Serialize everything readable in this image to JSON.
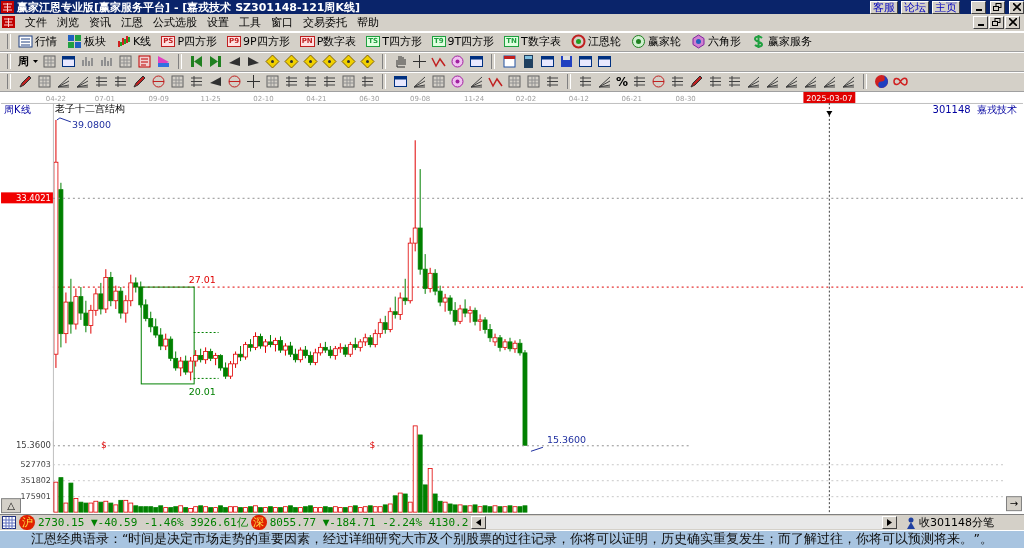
{
  "window": {
    "title": "赢家江恩专业版[赢家服务平台] - [嘉戎技术   SZ301148-121周K线]",
    "links": [
      "客服",
      "论坛",
      "主页"
    ]
  },
  "menu": [
    "文件",
    "浏览",
    "资讯",
    "江恩",
    "公式选股",
    "设置",
    "工具",
    "窗口",
    "交易委托",
    "帮助"
  ],
  "toolbar": [
    {
      "label": "行情"
    },
    {
      "label": "板块"
    },
    {
      "label": "K线"
    },
    {
      "badge": "PS",
      "label": "P四方形"
    },
    {
      "badge": "P9",
      "label": "9P四方形"
    },
    {
      "badge": "PN",
      "label": "P数字表"
    },
    {
      "badge": "TS",
      "label": "T四方形"
    },
    {
      "badge": "T9",
      "label": "9T四方形"
    },
    {
      "badge": "TN",
      "label": "T数字表"
    },
    {
      "label": "江恩轮"
    },
    {
      "label": "赢家轮"
    },
    {
      "label": "六角形"
    },
    {
      "label": "赢家服务"
    }
  ],
  "period_button": "周",
  "percent_button": "%",
  "chart": {
    "period_label": "周K线",
    "dates": [
      "04-22",
      "07-01",
      "09-09",
      "11-25",
      "02-10",
      "04-21",
      "06-30",
      "09-08",
      "11-24",
      "02-02",
      "04-12",
      "06-21",
      "08-30"
    ],
    "cursor_date": "2025-03-07",
    "security": "301148  嘉戎技术",
    "title": "老子十二宫结构",
    "high_label": "39.0800",
    "upper_level": "27.01",
    "lower_level": "20.01",
    "low_label": "15.3600",
    "markers": [
      "$",
      "$"
    ],
    "volume_toggle": "△",
    "scroll_right": "→",
    "chart_data": {
      "type": "candlestick",
      "ylim": [
        15.36,
        40.32
      ],
      "grid": true,
      "yticks": [
        {
          "value": 33.4021,
          "label": "33.4021"
        },
        {
          "value": 15.36,
          "label": "15.3600"
        }
      ],
      "categories": [
        null,
        null,
        null,
        null,
        null,
        null,
        null,
        null,
        null,
        null,
        null,
        null,
        null,
        null,
        null,
        null,
        null,
        null,
        null,
        null,
        null,
        null,
        null,
        null,
        null,
        null,
        null,
        null,
        null,
        null,
        null,
        null,
        null,
        null,
        null,
        null,
        null,
        null,
        null,
        null,
        null,
        null,
        null,
        null,
        null,
        null,
        null,
        null,
        null,
        null,
        null,
        null,
        null,
        null,
        null,
        null,
        null,
        null,
        null,
        null,
        null,
        null,
        null,
        null,
        null,
        null,
        null,
        null,
        null,
        null,
        null,
        null,
        null,
        null,
        null,
        null,
        null,
        null,
        null,
        null,
        null,
        null,
        null,
        null,
        null,
        null,
        null,
        null,
        null,
        null,
        null,
        null,
        null,
        null,
        null
      ],
      "ohlc": [
        [
          22,
          39.08,
          21,
          36
        ],
        [
          34,
          34.5,
          22.5,
          23.5
        ],
        [
          23.5,
          26.5,
          22.8,
          25.8
        ],
        [
          25.8,
          27.5,
          23.5,
          24.2
        ],
        [
          24.2,
          26.8,
          23.8,
          26.2
        ],
        [
          26.2,
          26.9,
          24.5,
          25
        ],
        [
          25,
          25.9,
          23.6,
          24.1
        ],
        [
          24.1,
          25.6,
          23.5,
          25.2
        ],
        [
          25.2,
          26.8,
          24.8,
          26.4
        ],
        [
          26.4,
          27.2,
          24.9,
          25.3
        ],
        [
          25.3,
          28.2,
          25,
          27.6
        ],
        [
          27.6,
          28,
          25.5,
          25.9
        ],
        [
          25.9,
          27,
          25.3,
          26.6
        ],
        [
          26.6,
          26.9,
          24.6,
          25
        ],
        [
          25,
          26.3,
          24.3,
          25.9
        ],
        [
          25.9,
          27.8,
          25.5,
          27.2
        ],
        [
          27.2,
          27.6,
          26.5,
          26.9
        ],
        [
          26.9,
          27.3,
          25.4,
          25.6
        ],
        [
          25.6,
          26,
          24.4,
          24.6
        ],
        [
          24.6,
          25.1,
          23.6,
          24
        ],
        [
          24,
          24.6,
          23.2,
          23.4
        ],
        [
          23.4,
          23.9,
          22.3,
          22.6
        ],
        [
          22.6,
          23.5,
          22.3,
          23.1
        ],
        [
          23.1,
          23.3,
          21.5,
          21.7
        ],
        [
          21.7,
          22.2,
          20.8,
          21
        ],
        [
          21,
          21.8,
          20.4,
          21.5
        ],
        [
          21.5,
          21.9,
          20.5,
          20.7
        ],
        [
          20.7,
          21.8,
          20.1,
          21.5
        ],
        [
          21.5,
          22.3,
          21.1,
          21.9
        ],
        [
          21.9,
          22.4,
          21.4,
          21.6
        ],
        [
          21.6,
          22.5,
          21.3,
          22.2
        ],
        [
          22.2,
          22.4,
          21.5,
          21.7
        ],
        [
          21.7,
          22.1,
          21.2,
          21.9
        ],
        [
          21.9,
          22,
          20.8,
          21
        ],
        [
          21,
          21.4,
          20.2,
          20.4
        ],
        [
          20.4,
          21.5,
          20.2,
          21.3
        ],
        [
          21.3,
          22.2,
          21,
          22
        ],
        [
          22,
          22.6,
          21.5,
          21.8
        ],
        [
          21.8,
          22.9,
          21.6,
          22.7
        ],
        [
          22.7,
          23.1,
          22.2,
          22.5
        ],
        [
          22.5,
          23.6,
          22.3,
          23.3
        ],
        [
          23.3,
          23.5,
          22.4,
          22.6
        ],
        [
          22.6,
          23.1,
          22.1,
          22.9
        ],
        [
          22.9,
          23.4,
          22.5,
          22.7
        ],
        [
          22.7,
          23.2,
          22.2,
          23
        ],
        [
          23,
          23.3,
          22.1,
          22.3
        ],
        [
          22.3,
          22.8,
          21.9,
          22.6
        ],
        [
          22.6,
          22.9,
          21.8,
          22
        ],
        [
          22,
          22.4,
          21.4,
          21.6
        ],
        [
          21.6,
          22.5,
          21.4,
          22.3
        ],
        [
          22.3,
          22.6,
          21.7,
          21.9
        ],
        [
          21.9,
          22.2,
          21.2,
          21.4
        ],
        [
          21.4,
          22.4,
          21.2,
          22.1
        ],
        [
          22.1,
          22.8,
          21.9,
          22.5
        ],
        [
          22.5,
          22.9,
          22.1,
          22.3
        ],
        [
          22.3,
          22.6,
          21.7,
          21.9
        ],
        [
          21.9,
          22.6,
          21.6,
          22.4
        ],
        [
          22.4,
          22.8,
          22.1,
          22.5
        ],
        [
          22.5,
          22.7,
          21.8,
          22
        ],
        [
          22,
          22.9,
          21.8,
          22.7
        ],
        [
          22.7,
          23.2,
          22.3,
          22.5
        ],
        [
          22.5,
          23.1,
          22.2,
          22.9
        ],
        [
          22.9,
          23.5,
          22.6,
          23.2
        ],
        [
          23.2,
          23.4,
          22.5,
          22.7
        ],
        [
          22.7,
          23.8,
          22.5,
          23.5
        ],
        [
          23.5,
          24.6,
          23.2,
          24.3
        ],
        [
          24.3,
          24.8,
          23.5,
          23.8
        ],
        [
          23.8,
          25.4,
          23.6,
          25.1
        ],
        [
          25.1,
          26.2,
          24.6,
          24.9
        ],
        [
          24.9,
          26.5,
          24.5,
          26.1
        ],
        [
          26.1,
          27.5,
          25.6,
          25.9
        ],
        [
          25.9,
          30.5,
          25.7,
          30.1
        ],
        [
          30.1,
          37.6,
          29.5,
          31.2
        ],
        [
          31.2,
          35.5,
          27.8,
          28.2
        ],
        [
          28.2,
          29.3,
          26.4,
          26.8
        ],
        [
          26.8,
          28.3,
          26.5,
          27.9
        ],
        [
          27.9,
          28.2,
          26.3,
          26.6
        ],
        [
          26.6,
          27,
          25.5,
          25.8
        ],
        [
          25.8,
          26.4,
          25.1,
          26.1
        ],
        [
          26.1,
          26.3,
          24.9,
          25.2
        ],
        [
          25.2,
          25.8,
          24.1,
          24.4
        ],
        [
          24.4,
          25.6,
          24.2,
          25.3
        ],
        [
          25.3,
          26,
          24.7,
          25
        ],
        [
          25,
          25.5,
          24.3,
          25.2
        ],
        [
          25.2,
          25.4,
          24.1,
          24.4
        ],
        [
          24.4,
          24.9,
          23.7,
          24.5
        ],
        [
          24.5,
          24.7,
          23.5,
          23.8
        ],
        [
          23.8,
          24.2,
          22.9,
          23.2
        ],
        [
          22.9,
          23.5,
          22.6,
          23.2
        ],
        [
          23.2,
          23.4,
          22.2,
          22.5
        ],
        [
          22.5,
          23.1,
          22.3,
          22.9
        ],
        [
          22.9,
          23.2,
          22.2,
          22.4
        ],
        [
          22.4,
          23,
          22.1,
          22.8
        ],
        [
          22.8,
          23.1,
          21.9,
          22.1
        ],
        [
          22.1,
          22.3,
          15.36,
          15.36
        ]
      ]
    },
    "volume": {
      "chart_data": {
        "type": "bar",
        "ylim": [
          0,
          1000000
        ],
        "grid": true,
        "categories": [
          null,
          null,
          null,
          null,
          null,
          null,
          null,
          null,
          null,
          null,
          null,
          null,
          null,
          null,
          null,
          null,
          null,
          null,
          null,
          null,
          null,
          null,
          null,
          null,
          null,
          null,
          null,
          null,
          null,
          null,
          null,
          null,
          null,
          null,
          null,
          null,
          null,
          null,
          null,
          null,
          null,
          null,
          null,
          null,
          null,
          null,
          null,
          null,
          null,
          null,
          null,
          null,
          null,
          null,
          null,
          null,
          null,
          null,
          null,
          null,
          null,
          null,
          null,
          null,
          null,
          null,
          null,
          null,
          null,
          null,
          null,
          null,
          null,
          null,
          null,
          null,
          null,
          null,
          null,
          null,
          null,
          null,
          null,
          null,
          null,
          null,
          null,
          null,
          null,
          null,
          null,
          null,
          null,
          null,
          null
        ],
        "yticks": [
          {
            "value": 527703,
            "label": "527703"
          },
          {
            "value": 351802,
            "label": "351802"
          },
          {
            "value": 175901,
            "label": "175901"
          }
        ],
        "values": [
          330000,
          380000,
          100000,
          320000,
          150000,
          110000,
          100000,
          100000,
          120000,
          110000,
          120000,
          100000,
          80000,
          130000,
          130000,
          100000,
          70000,
          60000,
          60000,
          60000,
          50000,
          70000,
          50000,
          50000,
          60000,
          70000,
          50000,
          40000,
          60000,
          70000,
          60000,
          50000,
          50000,
          70000,
          50000,
          60000,
          60000,
          50000,
          50000,
          60000,
          70000,
          50000,
          50000,
          60000,
          50000,
          50000,
          60000,
          70000,
          50000,
          50000,
          60000,
          70000,
          50000,
          50000,
          60000,
          50000,
          60000,
          50000,
          50000,
          60000,
          70000,
          50000,
          60000,
          70000,
          60000,
          60000,
          80000,
          90000,
          180000,
          210000,
          200000,
          110000,
          950000,
          850000,
          300000,
          480000,
          200000,
          120000,
          110000,
          90000,
          80000,
          80000,
          70000,
          70000,
          80000,
          60000,
          70000,
          60000,
          70000,
          60000,
          60000,
          70000,
          60000,
          60000,
          70000
        ]
      }
    }
  },
  "status_bar": {
    "indices": [
      {
        "badge": "沪",
        "text": "2730.15 ▼-40.59 -1.46% 3926.61亿"
      },
      {
        "badge": "深",
        "text": "8055.77 ▼-184.71 -2.24% 4130.2"
      }
    ],
    "right": "收301148分笔"
  },
  "quote": "江恩经典语录：“时间是决定市场走势的重要因素，经过详细研究大市及个别股票的过往记录，你将可以证明，历史确实重复发生；而了解过往，你将可以预测将来。”。"
}
